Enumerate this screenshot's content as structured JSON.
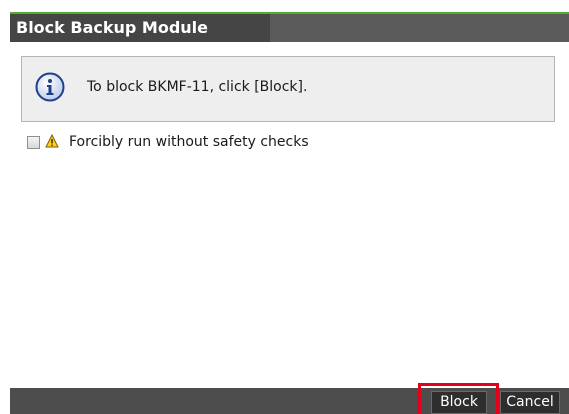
{
  "dialog": {
    "title": "Block Backup Module"
  },
  "info": {
    "icon": "info-icon",
    "message": "To block BKMF-11, click [Block]."
  },
  "option": {
    "icon": "warning-icon",
    "checked": false,
    "label": "Forcibly run without safety checks"
  },
  "footer": {
    "block_label": "Block",
    "cancel_label": "Cancel"
  },
  "colors": {
    "accent": "#4fae2f",
    "title_bar": "#5a5a5a",
    "footer": "#4d4d4d",
    "highlight": "#e3001b"
  }
}
